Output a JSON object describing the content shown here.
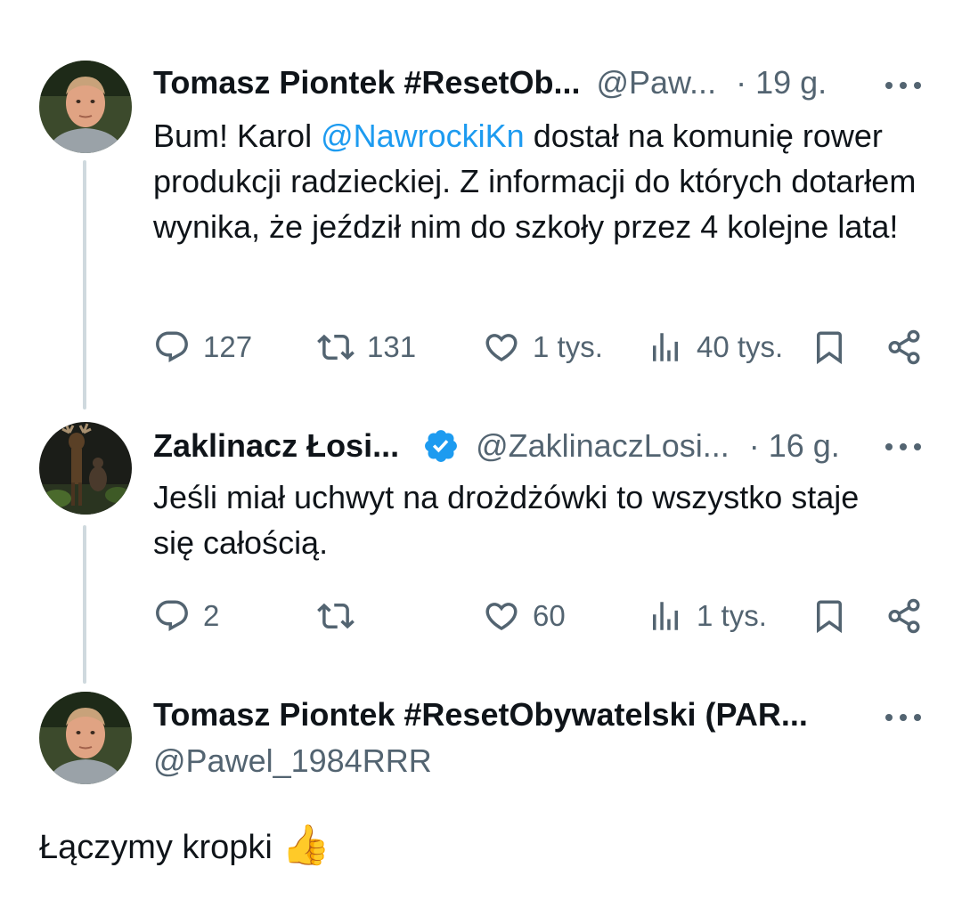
{
  "tweets": [
    {
      "author_name": "Tomasz Piontek #ResetOb...",
      "handle": "@Paw...",
      "time": "· 19 g.",
      "text_before": "Bum! Karol ",
      "mention": "@NawrockiKn",
      "text_after": " dostał na komunię rower produkcji radzieckiej. Z informacji do których dotarłem wynika, że jeździł nim do szkoły przez 4 kolejne lata!",
      "replies": "127",
      "reposts": "131",
      "likes": "1 tys.",
      "views": "40 tys."
    },
    {
      "author_name": "Zaklinacz Łosi...",
      "verified": true,
      "handle": "@ZaklinaczLosi...",
      "time": "· 16 g.",
      "text": "Jeśli miał uchwyt na drożdżówki to wszystko staje się całością.",
      "replies": "2",
      "reposts": "",
      "likes": "60",
      "views": "1 tys."
    }
  ],
  "main_post": {
    "author_name": "Tomasz Piontek #ResetObywatelski (PAR...",
    "handle": "@Pawel_1984RRR",
    "text": "Łączymy kropki",
    "emoji": "👍"
  },
  "colors": {
    "accent": "#1d9bf0",
    "secondary_text": "#536471",
    "thread_line": "#cfd9de"
  },
  "icons": [
    "reply-icon",
    "repost-icon",
    "like-icon",
    "views-icon",
    "bookmark-icon",
    "share-icon",
    "more-icon",
    "verified-icon"
  ]
}
